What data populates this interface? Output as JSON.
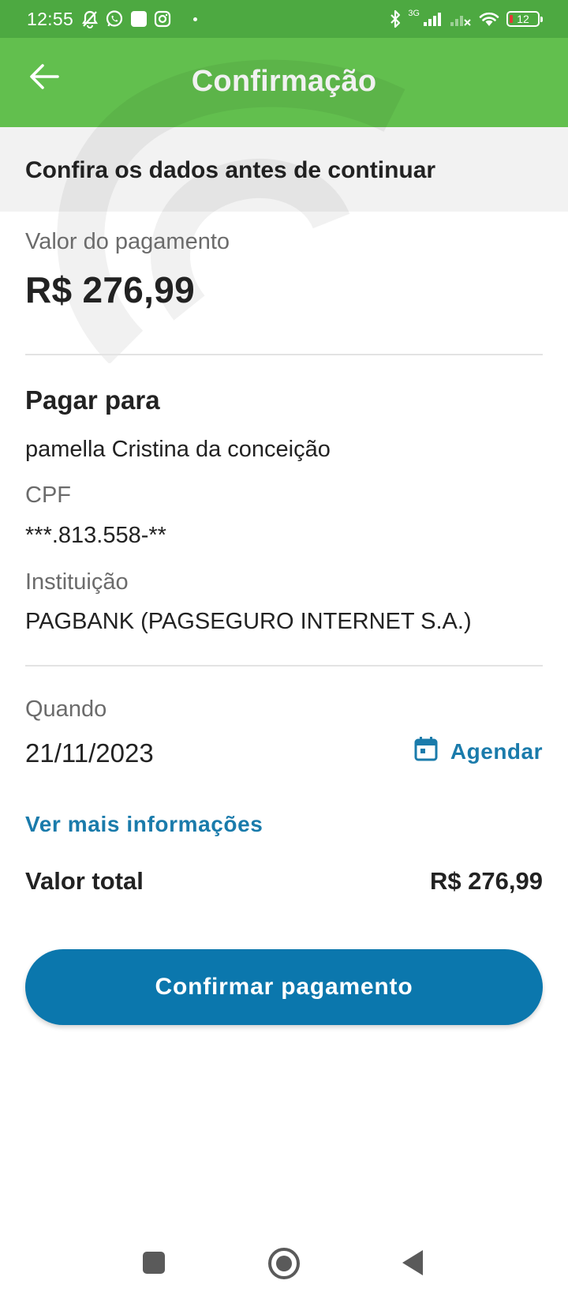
{
  "status_bar": {
    "time": "12:55",
    "network_label": "3G",
    "battery": "12",
    "left_icons": [
      "mute-icon",
      "whatsapp-icon",
      "app-square-icon",
      "instagram-icon"
    ],
    "right_icons": [
      "bluetooth-icon",
      "signal-icon",
      "signal-off-icon",
      "wifi-icon",
      "battery-icon"
    ]
  },
  "app_bar": {
    "title": "Confirmação",
    "back_icon": "arrow-left-icon"
  },
  "banner": {
    "text": "Confira os dados antes de continuar"
  },
  "payment": {
    "amount_label": "Valor do pagamento",
    "amount": "R$ 276,99"
  },
  "recipient": {
    "section_title": "Pagar para",
    "name": "pamella Cristina da conceição",
    "cpf_label": "CPF",
    "cpf": "***.813.558-**",
    "institution_label": "Instituição",
    "institution": "PAGBANK (PAGSEGURO INTERNET S.A.)"
  },
  "schedule": {
    "when_label": "Quando",
    "date": "21/11/2023",
    "schedule_button": "Agendar",
    "schedule_icon": "calendar-icon"
  },
  "more_info_link": "Ver mais informações",
  "total": {
    "label": "Valor total",
    "value": "R$ 276,99"
  },
  "confirm_button": "Confirmar pagamento",
  "nav_bar": {
    "buttons": [
      "recent-apps-icon",
      "home-icon",
      "back-icon"
    ]
  },
  "colors": {
    "status_bar": "#4da941",
    "app_bar": "#62bf4e",
    "accent": "#0b77ad",
    "link": "#1a7bab",
    "banner_bg": "#f2f2f2"
  }
}
